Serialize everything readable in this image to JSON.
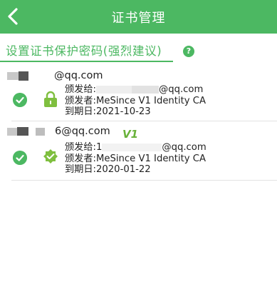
{
  "header": {
    "title": "证书管理",
    "back_icon": "chevron-left-icon"
  },
  "password_link": {
    "label": "设置证书保护密码(强烈建议)",
    "help_icon": "question-icon"
  },
  "colors": {
    "brand": "#4cb862",
    "text": "#222222"
  },
  "certificates": [
    {
      "email_visible": "@qq.com",
      "issued_to_label": "颁发给:",
      "issued_to_value": "@qq.com",
      "issuer_label": "颁发者:",
      "issuer": "MeSince V1 Identity CA",
      "expiry_label": "到期日:",
      "expiry": "2021-10-23",
      "icon": "lock-icon",
      "status_icon": "check-icon"
    },
    {
      "email_visible": "6@qq.com",
      "issued_to_label": "颁发给:",
      "issued_to_value": "1",
      "issued_to_value_suffix": "@qq.com",
      "issuer_label": "颁发者:",
      "issuer": "MeSince V1 Identity CA",
      "expiry_label": "到期日:",
      "expiry": "2020-01-22",
      "icon": "verified-badge-icon",
      "status_icon": "check-icon",
      "logo_text": "V1"
    }
  ]
}
